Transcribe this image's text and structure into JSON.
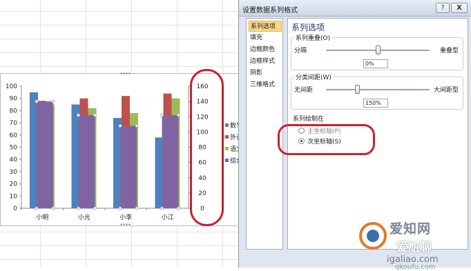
{
  "dialog": {
    "title": "设置数据系列格式",
    "help_label": "?",
    "close_label": "X",
    "nav_items": [
      "系列选项",
      "填充",
      "边框颜色",
      "边框样式",
      "阴影",
      "三维格式"
    ],
    "section_title": "系列选项",
    "overlap": {
      "group_label": "系列重叠(O)",
      "left_label": "分隔",
      "right_label": "重叠型",
      "value": "0%",
      "level": 0.5
    },
    "gap": {
      "group_label": "分类间距(W)",
      "left_label": "无间距",
      "right_label": "大间距型",
      "value": "150%",
      "level": 0.3
    },
    "plot_on": {
      "group_label": "系列绘制在",
      "primary_label": "主坐标轴(P)",
      "secondary_label": "次坐标轴(S)",
      "selected": "secondary"
    }
  },
  "chart_data": {
    "type": "bar",
    "categories": [
      "小明",
      "小光",
      "小李",
      "小江"
    ],
    "ylim_left": [
      0,
      100
    ],
    "yticks_left": [
      0,
      10,
      20,
      30,
      40,
      50,
      60,
      70,
      80,
      90,
      100
    ],
    "ylim_right": [
      0,
      160
    ],
    "yticks_right": [
      0,
      20,
      40,
      60,
      80,
      100,
      120,
      140,
      160
    ],
    "grid": false,
    "legend_position": "right",
    "series": [
      {
        "name": "数学",
        "axis": "primary",
        "color": "#4f81bd",
        "values": [
          95,
          85,
          74,
          58
        ]
      },
      {
        "name": "外语",
        "axis": "primary",
        "color": "#c0504d",
        "values": [
          88,
          90,
          92,
          94
        ]
      },
      {
        "name": "语文",
        "axis": "primary",
        "color": "#9bbb59",
        "values": [
          85,
          82,
          78,
          90
        ]
      },
      {
        "name": "综合",
        "axis": "secondary",
        "color": "#8064a2",
        "values": [
          140,
          122,
          108,
          122
        ]
      }
    ],
    "legend_labels": [
      "数学",
      "外语",
      "语文",
      "综合"
    ]
  },
  "watermark": {
    "line1": "爱知网",
    "line2": "爱尬聊",
    "line3": "igaliao.com",
    "line4": "qkoufu.com"
  }
}
